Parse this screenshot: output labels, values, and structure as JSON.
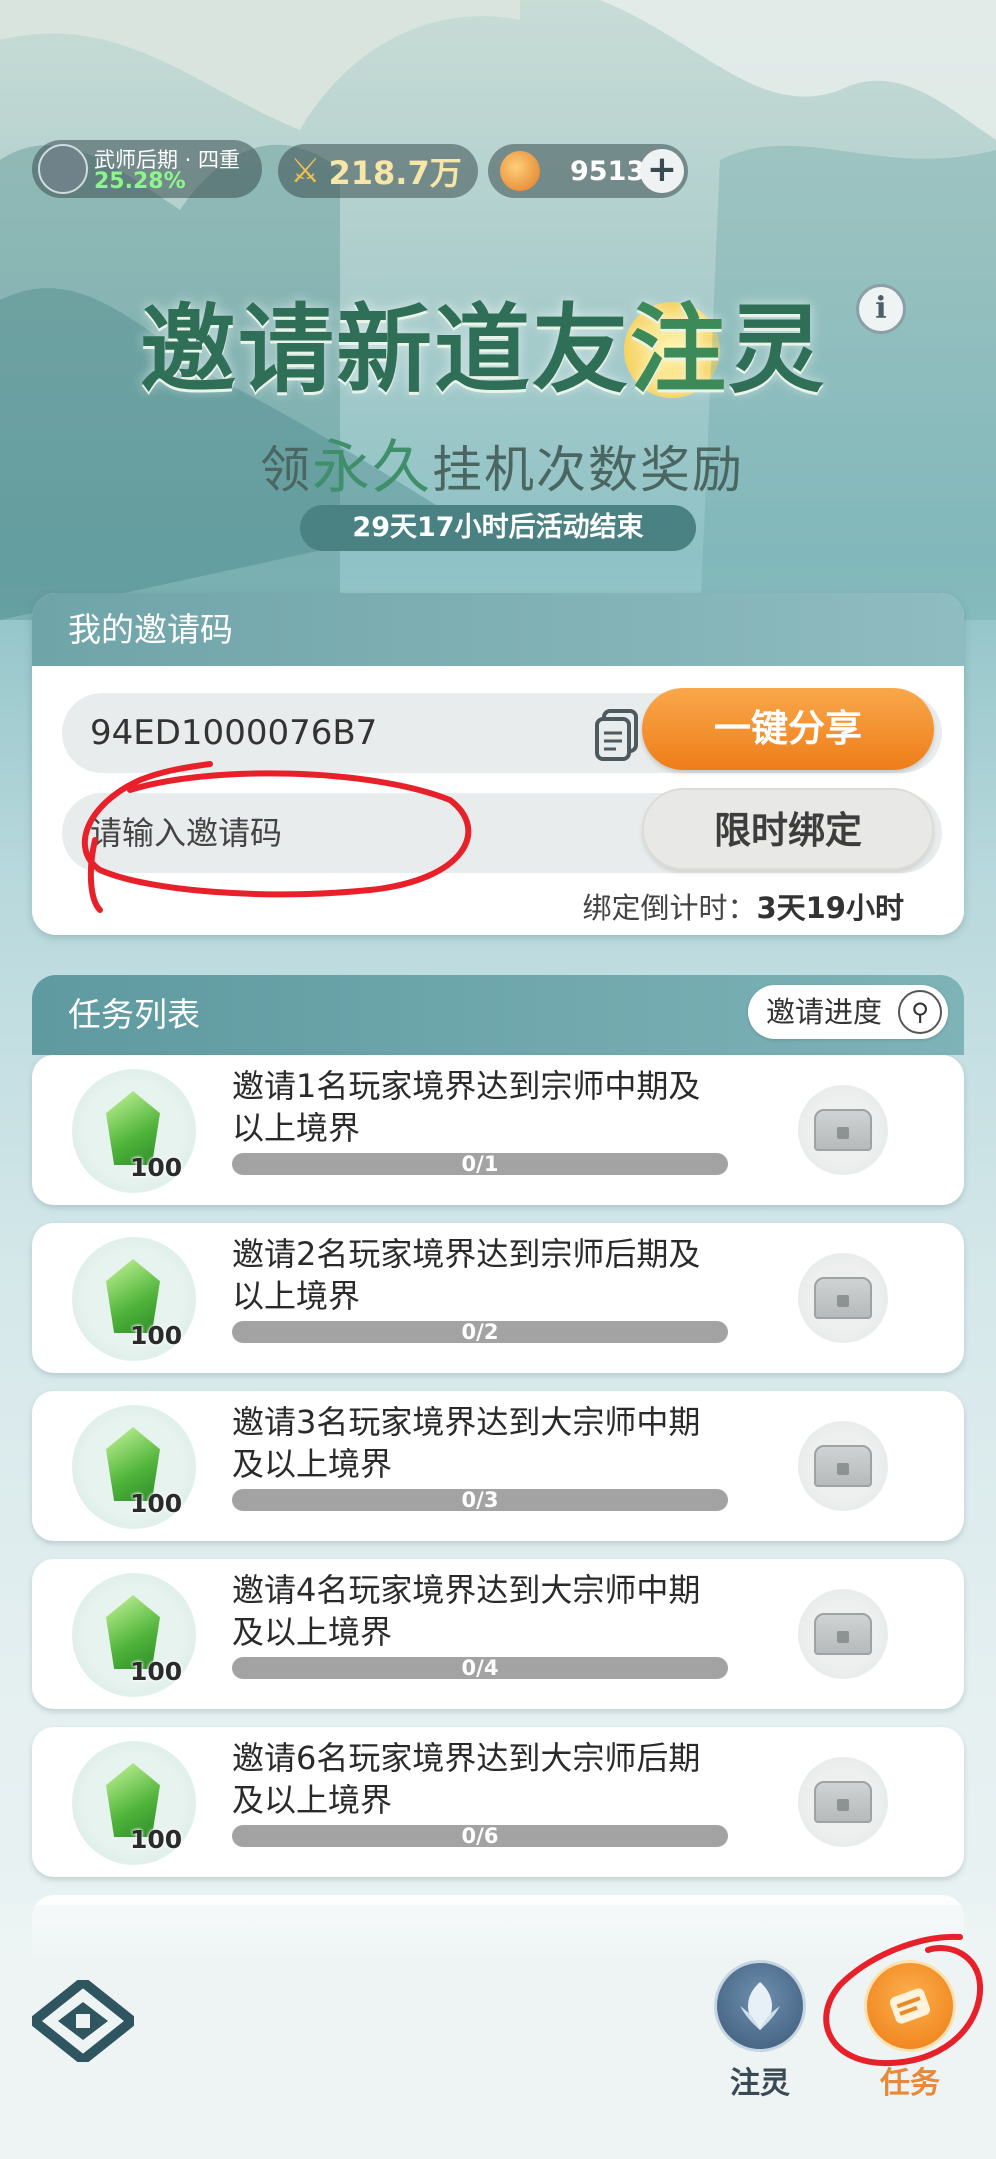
{
  "status_bar": {
    "realm": "武师后期 · 四重",
    "realm_progress": "25.28%",
    "combat_power": "218.7万",
    "currency": "9513",
    "add_label": "+"
  },
  "banner": {
    "title_part1": "邀请新道友",
    "title_highlight": "注",
    "title_part2": "灵",
    "subtitle_part1": "领",
    "subtitle_em": "永久",
    "subtitle_part2": "挂机次数奖励",
    "countdown": "29天17小时后活动结束",
    "info_label": "i"
  },
  "invite_panel": {
    "header": "我的邀请码",
    "my_code": "94ED1000076B7",
    "share_button": "一键分享",
    "input_placeholder": "请输入邀请码",
    "bind_button": "限时绑定",
    "bind_countdown_label": "绑定倒计时：",
    "bind_countdown_value": "3天19小时"
  },
  "task_panel": {
    "header": "任务列表",
    "progress_button": "邀请进度",
    "tasks": [
      {
        "desc": "邀请1名玩家境界达到宗师中期及以上境界",
        "progress_text": "0/1",
        "progress": 0,
        "reward_qty": "100"
      },
      {
        "desc": "邀请2名玩家境界达到宗师后期及以上境界",
        "progress_text": "0/2",
        "progress": 0,
        "reward_qty": "100"
      },
      {
        "desc": "邀请3名玩家境界达到大宗师中期及以上境界",
        "progress_text": "0/3",
        "progress": 0,
        "reward_qty": "100"
      },
      {
        "desc": "邀请4名玩家境界达到大宗师中期及以上境界",
        "progress_text": "0/4",
        "progress": 0,
        "reward_qty": "100"
      },
      {
        "desc": "邀请6名玩家境界达到大宗师后期及以上境界",
        "progress_text": "0/6",
        "progress": 0,
        "reward_qty": "100"
      }
    ]
  },
  "bottom_nav": {
    "item1": "注灵",
    "item2": "任务"
  },
  "colors": {
    "accent_orange": "#ee7d19",
    "teal_header": "#6fa4a8",
    "annotation_red": "#e8202a"
  }
}
